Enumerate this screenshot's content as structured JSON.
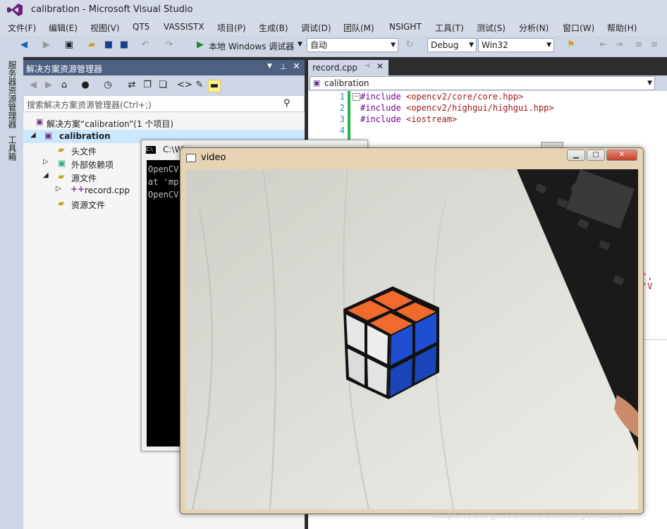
{
  "app": {
    "title": "calibration - Microsoft Visual Studio",
    "logo_icon": "visual-studio-logo"
  },
  "menu": [
    "文件(F)",
    "编辑(E)",
    "视图(V)",
    "QT5",
    "VASSISTX",
    "项目(P)",
    "生成(B)",
    "调试(D)",
    "团队(M)",
    "NSIGHT",
    "工具(T)",
    "测试(S)",
    "分析(N)",
    "窗口(W)",
    "帮助(H)"
  ],
  "toolbar": {
    "start_label": "本地 Windows 调试器",
    "auto_combo": "自动",
    "config_combo": "Debug",
    "platform_combo": "Win32"
  },
  "side_tabs": {
    "server_explorer": "服务器资源管理器",
    "toolbox": "工具箱"
  },
  "solution_explorer": {
    "title": "解决方案资源管理器",
    "search_placeholder": "搜索解决方案资源管理器(Ctrl+;)",
    "solution_label": "解决方案“calibration”(1 个项目)",
    "project": "calibration",
    "items": {
      "header_files": "头文件",
      "external_deps": "外部依赖项",
      "source_files": "源文件",
      "record_cpp": "record.cpp",
      "resource_files": "资源文件"
    }
  },
  "editor": {
    "tab_label": "record.cpp",
    "nav_scope": "calibration",
    "lines": [
      {
        "no": "1",
        "kw": "#include",
        "arg": "<opencv2/core/core.hpp>"
      },
      {
        "no": "2",
        "kw": "#include",
        "arg": "<opencv2/highgui/highgui.hpp>"
      },
      {
        "no": "3",
        "kw": "#include",
        "arg": "<iostream>"
      },
      {
        "no": "4",
        "kw": "",
        "arg": ""
      }
    ],
    "partial_text": "', 'V"
  },
  "console": {
    "title": "C:\\Wi",
    "lines": [
      "OpenCV",
      "at 'mp",
      "OpenCV"
    ]
  },
  "video_window": {
    "title": "video"
  },
  "watermark": "https://blog.csdn.net/zhengxi1100",
  "colors": {
    "accent": "#4d6082",
    "selected": "#cce8ff",
    "cube_orange": "#f06a2e",
    "cube_blue": "#1e4fd0"
  }
}
